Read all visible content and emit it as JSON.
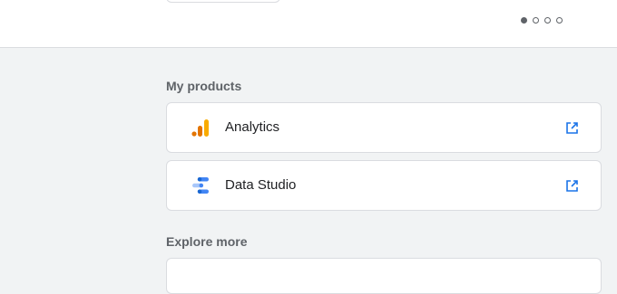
{
  "carousel": {
    "total": 4,
    "active_index": 0
  },
  "my_products": {
    "title": "My products",
    "items": [
      {
        "label": "Analytics",
        "icon": "analytics-logo-icon"
      },
      {
        "label": "Data Studio",
        "icon": "data-studio-logo-icon"
      }
    ]
  },
  "explore_more": {
    "title": "Explore more"
  },
  "colors": {
    "analytics_orange": "#f9ab00",
    "analytics_dark_orange": "#e37400",
    "data_studio_blue": "#4285f4",
    "data_studio_light_blue": "#a8c7fa",
    "link_blue": "#1a73e8"
  }
}
